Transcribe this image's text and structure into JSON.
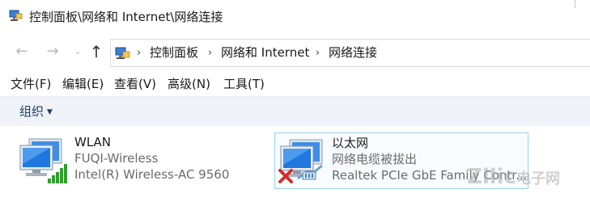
{
  "window": {
    "title": "控制面板\\网络和 Internet\\网络连接"
  },
  "nav": {
    "back_glyph": "←",
    "forward_glyph": "→",
    "dropdown_glyph": "⌄",
    "up_glyph": "↑"
  },
  "address": {
    "crumbs": [
      "控制面板",
      "网络和 Internet",
      "网络连接"
    ],
    "separator": "›"
  },
  "menu": {
    "items": [
      "文件(F)",
      "编辑(E)",
      "查看(V)",
      "高级(N)",
      "工具(T)"
    ]
  },
  "command_bar": {
    "organize_label": "组织"
  },
  "adapters": [
    {
      "name": "WLAN",
      "status": "FUQI-Wireless",
      "device": "Intel(R) Wireless-AC 9560",
      "icon": "wifi-signal-icon",
      "status_color": "#2f9e2f"
    },
    {
      "name": "以太网",
      "status": "网络电缆被拔出",
      "device": "Realtek PCIe GbE Family Contr...",
      "icon": "ethernet-disconnected-icon",
      "status_color": "#d62b2b"
    }
  ],
  "watermark": {
    "text": "Zilic",
    "suffix": "电子网"
  },
  "colors": {
    "accent": "#1e3f66",
    "selection_border": "#99d1f0",
    "command_bar_bg": "#f0f4f9"
  }
}
